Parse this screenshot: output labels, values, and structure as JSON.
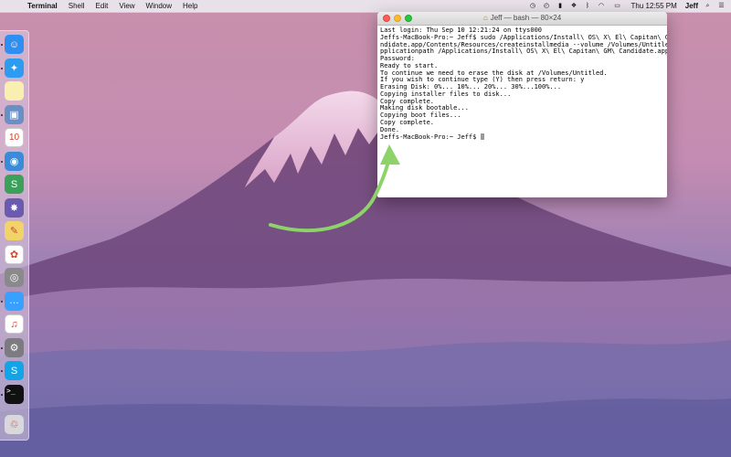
{
  "menubar": {
    "apple": "",
    "app_name": "Terminal",
    "items": [
      "Shell",
      "Edit",
      "View",
      "Window",
      "Help"
    ],
    "status_icons": [
      "time-machine-icon",
      "clock-icon",
      "clipboard-icon",
      "dropbox-icon",
      "bluetooth-icon",
      "wifi-icon",
      "battery-icon"
    ],
    "clock": "Thu 12:55 PM",
    "user": "Jeff"
  },
  "terminal": {
    "title": "Jeff — bash — 80×24",
    "lines": [
      "Last login: Thu Sep 10 12:21:24 on ttys000",
      "Jeffs-MacBook-Pro:~ Jeff$ sudo /Applications/Install\\ OS\\ X\\ El\\ Capitan\\ GM\\ Ca",
      "ndidate.app/Contents/Resources/createinstallmedia --volume /Volumes/Untitled --a",
      "pplicationpath /Applications/Install\\ OS\\ X\\ El\\ Capitan\\ GM\\ Candidate.app",
      "Password:",
      "Ready to start.",
      "To continue we need to erase the disk at /Volumes/Untitled.",
      "If you wish to continue type (Y) then press return: y",
      "Erasing Disk: 0%... 10%... 20%... 30%...100%...",
      "Copying installer files to disk...",
      "Copy complete.",
      "Making disk bootable...",
      "Copying boot files...",
      "Copy complete.",
      "Done."
    ],
    "prompt": "Jeffs-MacBook-Pro:~ Jeff$ "
  },
  "dock": {
    "apps": [
      {
        "name": "finder-icon",
        "glyph": "☺",
        "color": "#2f8ef0",
        "running": true
      },
      {
        "name": "safari-icon",
        "glyph": "✦",
        "color": "#2d9cf0",
        "running": true
      },
      {
        "name": "notes-icon",
        "glyph": "",
        "color": "#f8efb0",
        "running": false
      },
      {
        "name": "preview-icon",
        "glyph": "▣",
        "color": "#6a8fc4",
        "running": true
      },
      {
        "name": "calendar-icon",
        "glyph": "10",
        "color": "#ffffff",
        "running": false
      },
      {
        "name": "tweetbot-icon",
        "glyph": "◉",
        "color": "#3a8bd8",
        "running": true
      },
      {
        "name": "stuffit-icon",
        "glyph": "S",
        "color": "#3aa05a",
        "running": false
      },
      {
        "name": "imovie-icon",
        "glyph": "✸",
        "color": "#6a5bb0",
        "running": false
      },
      {
        "name": "pencil-app-icon",
        "glyph": "✎",
        "color": "#f1d36a",
        "running": false
      },
      {
        "name": "photos-icon",
        "glyph": "✿",
        "color": "#ffffff",
        "running": false
      },
      {
        "name": "screenshot-app-icon",
        "glyph": "◎",
        "color": "#8a8a8a",
        "running": false
      },
      {
        "name": "messages-icon",
        "glyph": "…",
        "color": "#3aa0ff",
        "running": true
      },
      {
        "name": "itunes-icon",
        "glyph": "♫",
        "color": "#ffffff",
        "running": false
      },
      {
        "name": "system-preferences-icon",
        "glyph": "⚙",
        "color": "#7b7b80",
        "running": true
      },
      {
        "name": "skype-icon",
        "glyph": "S",
        "color": "#11a5e8",
        "running": true
      },
      {
        "name": "terminal-icon",
        "glyph": ">_",
        "color": "#111111",
        "running": true
      },
      {
        "name": "trash-icon",
        "glyph": "♲",
        "color": "#d8d8dc",
        "running": false
      }
    ]
  },
  "colors": {
    "arrow": "#8ed36a",
    "menubar": "#ece8ee"
  }
}
